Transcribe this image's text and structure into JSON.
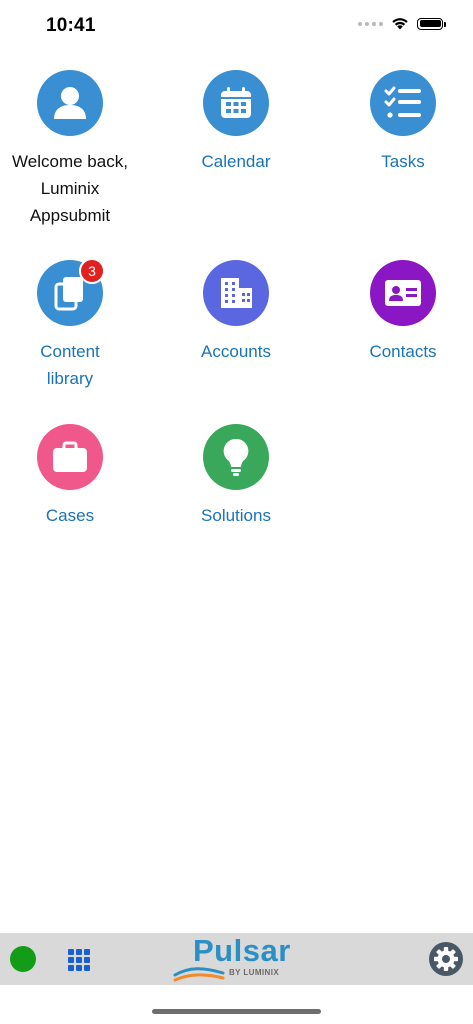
{
  "status_bar": {
    "time": "10:41"
  },
  "tiles": [
    {
      "id": "welcome",
      "label": "Welcome back, Luminix Appsubmit",
      "icon": "user-icon",
      "color": "#3a8fd2"
    },
    {
      "id": "calendar",
      "label": "Calendar",
      "icon": "calendar-icon",
      "color": "#3a8fd2"
    },
    {
      "id": "tasks",
      "label": "Tasks",
      "icon": "checklist-icon",
      "color": "#3a8fd2"
    },
    {
      "id": "content-library",
      "label": "Content library",
      "icon": "files-icon",
      "color": "#3a8fd2",
      "badge": "3"
    },
    {
      "id": "accounts",
      "label": "Accounts",
      "icon": "building-icon",
      "color": "#5a67e0"
    },
    {
      "id": "contacts",
      "label": "Contacts",
      "icon": "contact-card-icon",
      "color": "#8a16c4"
    },
    {
      "id": "cases",
      "label": "Cases",
      "icon": "briefcase-icon",
      "color": "#f0588b"
    },
    {
      "id": "solutions",
      "label": "Solutions",
      "icon": "lightbulb-icon",
      "color": "#3aa85b"
    }
  ],
  "bottom_bar": {
    "status_color": "#139c17",
    "logo_text": "Pulsar",
    "logo_sub": "BY LUMINIX",
    "accent": "#2a8fc4"
  }
}
